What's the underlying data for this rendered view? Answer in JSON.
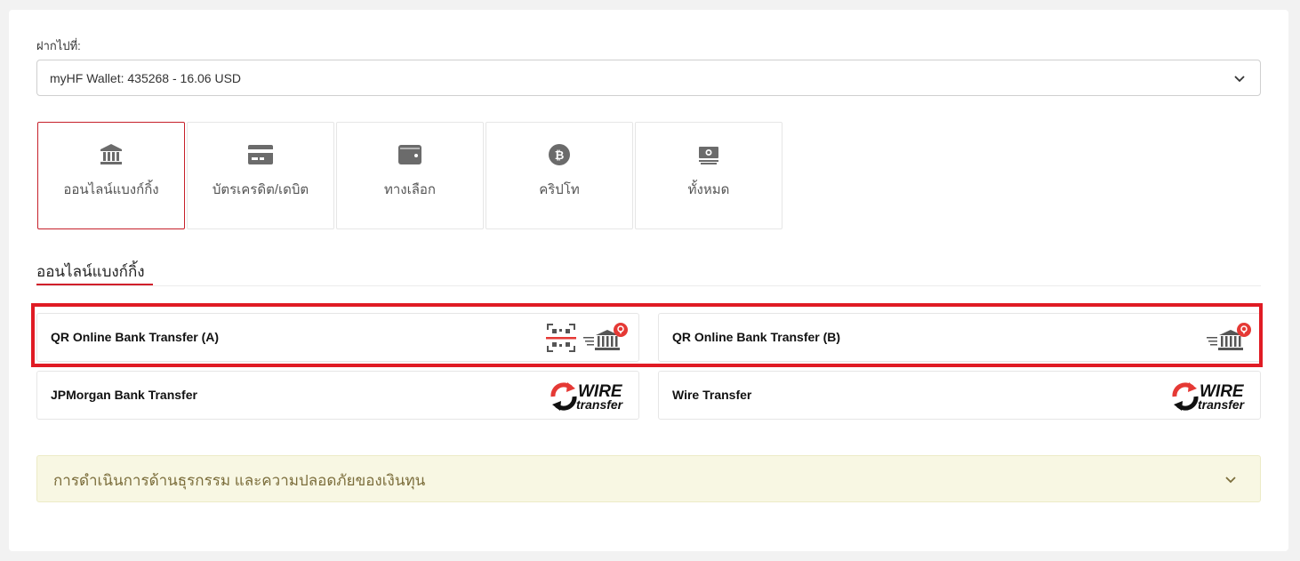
{
  "deposit": {
    "label": "ฝากไปที่:",
    "selected_wallet": "myHF Wallet: 435268 - 16.06 USD"
  },
  "methods": [
    {
      "label": "ออนไลน์แบงก์กิ้ง",
      "icon": "bank-icon",
      "active": true
    },
    {
      "label": "บัตรเครดิต/เดบิต",
      "icon": "credit-card-icon",
      "active": false
    },
    {
      "label": "ทางเลือก",
      "icon": "wallet-icon",
      "active": false
    },
    {
      "label": "คริปโท",
      "icon": "bitcoin-icon",
      "active": false
    },
    {
      "label": "ทั้งหมด",
      "icon": "cash-icon",
      "active": false
    }
  ],
  "section": {
    "title": "ออนไลน์แบงก์กิ้ง"
  },
  "options": [
    {
      "name": "QR Online Bank Transfer (A)",
      "logo": "qr-bank-logo"
    },
    {
      "name": "QR Online Bank Transfer (B)",
      "logo": "bank-transfer-logo"
    },
    {
      "name": "JPMorgan Bank Transfer",
      "logo": "wire-transfer-logo"
    },
    {
      "name": "Wire Transfer",
      "logo": "wire-transfer-logo"
    }
  ],
  "wire_logo": {
    "line1": "WIRE",
    "line2": "transfer"
  },
  "faq": {
    "label": "การดำเนินการด้านธุรกรรม และความปลอดภัยของเงินทุน"
  },
  "colors": {
    "accent": "#d11f2b",
    "highlight": "#e01b24",
    "icon_gray": "#6b6b6b",
    "faq_bg": "#f8f7e3",
    "faq_text": "#7b6d3b"
  }
}
